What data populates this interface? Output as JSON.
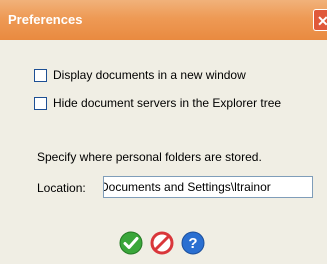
{
  "window": {
    "title": "Preferences",
    "close_glyph": "✕"
  },
  "options": [
    {
      "label": "Display documents in a new window",
      "checked": false
    },
    {
      "label": "Hide document servers in the Explorer tree",
      "checked": false
    }
  ],
  "folders": {
    "description": "Specify where personal folders are stored.",
    "location_label": "Location:",
    "location_value": "Documents and Settings\\ltrainor"
  },
  "buttons": {
    "ok_icon": "check-icon",
    "cancel_icon": "cancel-icon",
    "help_icon": "help-icon"
  },
  "colors": {
    "title_bar": "#ee9a55",
    "ok": "#3aa63a",
    "cancel": "#d9363a",
    "help": "#2a6fd1"
  }
}
